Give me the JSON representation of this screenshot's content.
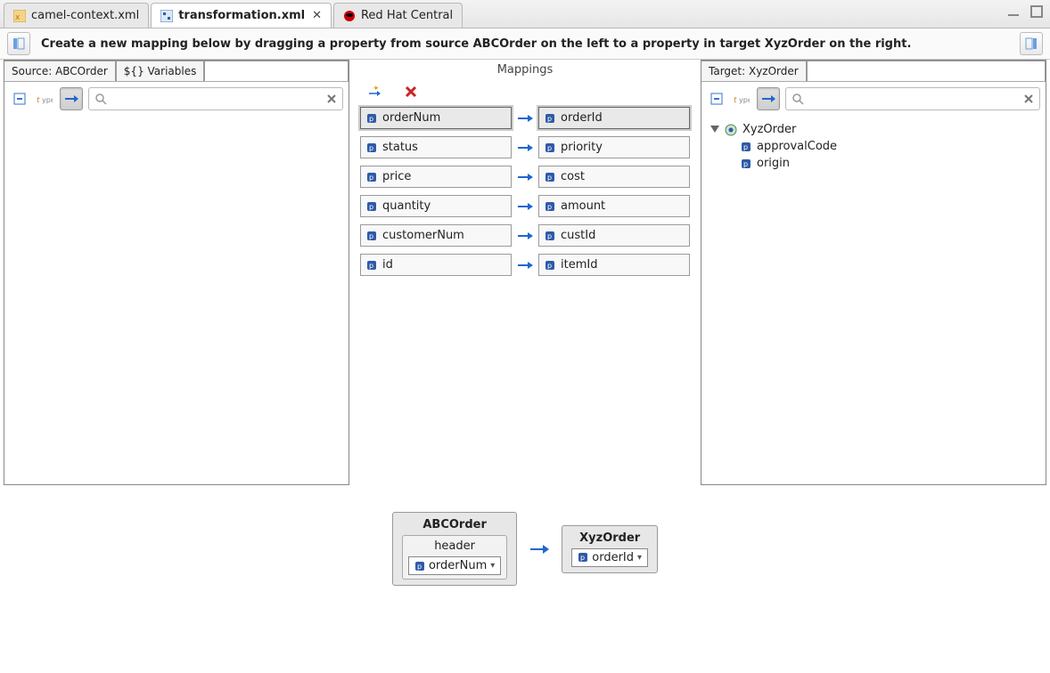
{
  "tabs": [
    {
      "label": "camel-context.xml",
      "icon": "xml"
    },
    {
      "label": "transformation.xml",
      "icon": "transform"
    },
    {
      "label": "Red Hat Central",
      "icon": "redhat"
    }
  ],
  "activeTab": 1,
  "hint": "Create a new mapping below by dragging a property from source ABCOrder on the left to a property in target XyzOrder  on the right.",
  "sourcePanel": {
    "title": "Source: ABCOrder",
    "variablesTab": "${} Variables",
    "search": ""
  },
  "targetPanel": {
    "title": "Target: XyzOrder",
    "search": "",
    "tree": {
      "root": "XyzOrder",
      "children": [
        {
          "name": "approvalCode"
        },
        {
          "name": "origin"
        }
      ]
    }
  },
  "mappingsTitle": "Mappings",
  "mappings": [
    {
      "source": "orderNum",
      "target": "orderId",
      "selected": true
    },
    {
      "source": "status",
      "target": "priority"
    },
    {
      "source": "price",
      "target": "cost"
    },
    {
      "source": "quantity",
      "target": "amount"
    },
    {
      "source": "customerNum",
      "target": "custId"
    },
    {
      "source": "id",
      "target": "itemId"
    }
  ],
  "detail": {
    "source": {
      "root": "ABCOrder",
      "sub": "header",
      "field": "orderNum"
    },
    "target": {
      "root": "XyzOrder",
      "field": "orderId"
    }
  }
}
